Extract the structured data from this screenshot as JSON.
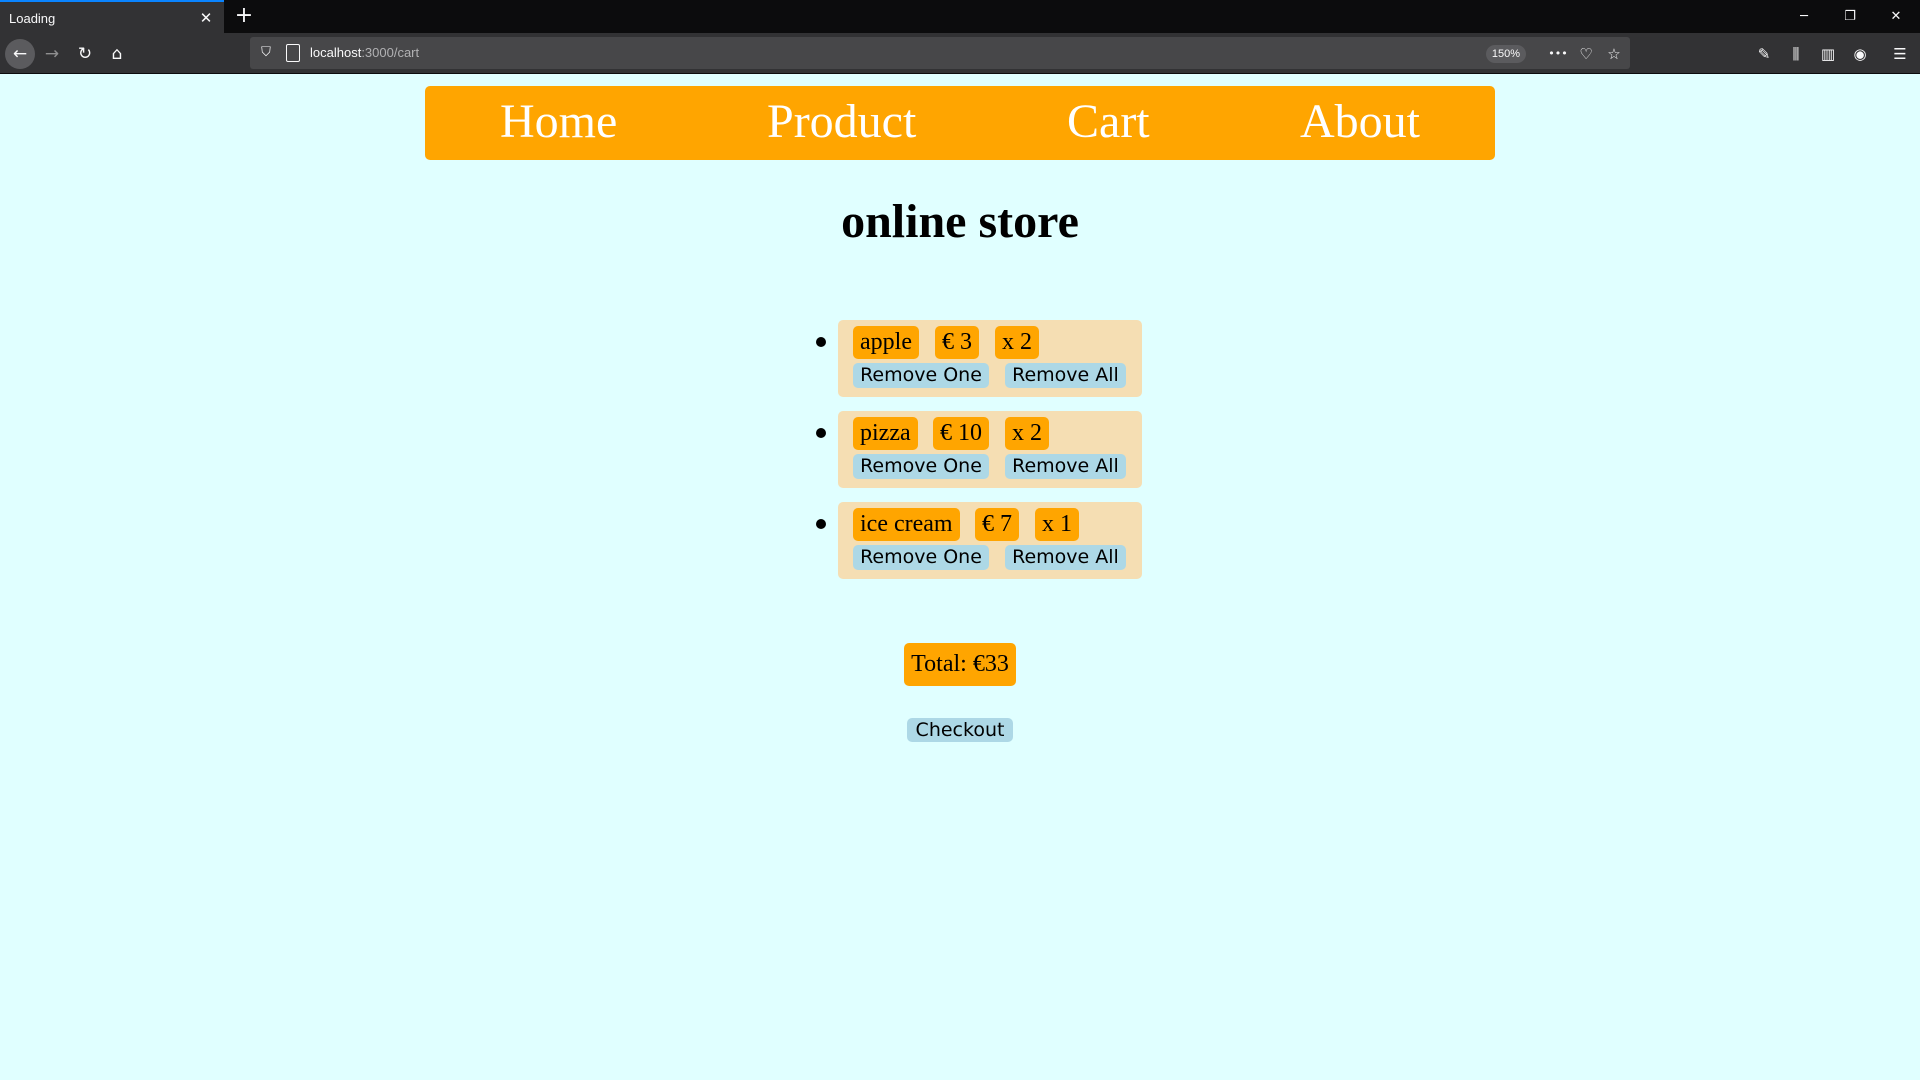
{
  "browser": {
    "tab_title": "Loading",
    "tab_close_glyph": "✕",
    "new_tab_glyph": "+",
    "window_controls": {
      "minimize": "─",
      "restore": "❐",
      "close": "✕"
    },
    "nav_icons": {
      "back": "←",
      "forward": "→",
      "reload": "↻",
      "home": "⌂"
    },
    "url_host": "localhost",
    "url_path": ":3000/cart",
    "zoom_level": "150%",
    "url_icons": {
      "more": "•••",
      "pocket": "♡",
      "bookmark": "☆"
    },
    "toolbar_icons": {
      "tools": "✎",
      "library": "⫼",
      "sidebar": "▥",
      "account": "◉",
      "menu": "☰"
    }
  },
  "site_nav": {
    "home": "Home",
    "product": "Product",
    "cart": "Cart",
    "about": "About"
  },
  "page_title": "online store",
  "cart_items": [
    {
      "name": "apple",
      "price": "€ 3",
      "quantity": "x 2",
      "remove_one": "Remove One",
      "remove_all": "Remove All"
    },
    {
      "name": "pizza",
      "price": "€ 10",
      "quantity": "x 2",
      "remove_one": "Remove One",
      "remove_all": "Remove All"
    },
    {
      "name": "ice cream",
      "price": "€ 7",
      "quantity": "x 1",
      "remove_one": "Remove One",
      "remove_all": "Remove All"
    }
  ],
  "total": "Total: €33",
  "checkout_label": "Checkout",
  "colors": {
    "page_background": "#e0ffff",
    "accent_orange": "#ffa500",
    "item_background": "#f5deb3",
    "button_blue": "#add8e6"
  }
}
